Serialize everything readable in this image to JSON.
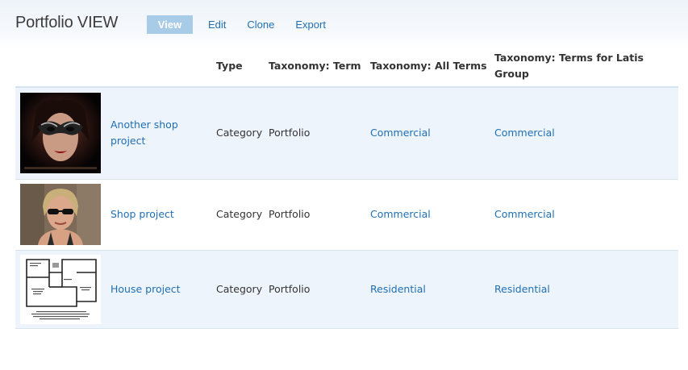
{
  "page": {
    "title": "Portfolio VIEW"
  },
  "tabs": [
    {
      "label": "View",
      "active": true
    },
    {
      "label": "Edit",
      "active": false
    },
    {
      "label": "Clone",
      "active": false
    },
    {
      "label": "Export",
      "active": false
    }
  ],
  "table": {
    "headers": {
      "image": "",
      "title": "",
      "type": "Type",
      "term": "Taxonomy: Term",
      "all_terms": "Taxonomy: All Terms",
      "latis": "Taxonomy: Terms for Latis Group"
    },
    "rows": [
      {
        "image": "masquerade-mask-photo",
        "title": "Another shop project",
        "type": "Category",
        "term": "Portfolio",
        "all_terms": "Commercial",
        "latis": "Commercial"
      },
      {
        "image": "woman-sunglasses-photo",
        "title": "Shop project",
        "type": "Category",
        "term": "Portfolio",
        "all_terms": "Commercial",
        "latis": "Commercial"
      },
      {
        "image": "house-floor-plan",
        "title": "House project",
        "type": "Category",
        "term": "Portfolio",
        "all_terms": "Residential",
        "latis": "Residential"
      }
    ]
  },
  "colors": {
    "link": "#1f6fb3",
    "active_tab": "#a8cbe7",
    "row_alt": "#eef4fb"
  }
}
